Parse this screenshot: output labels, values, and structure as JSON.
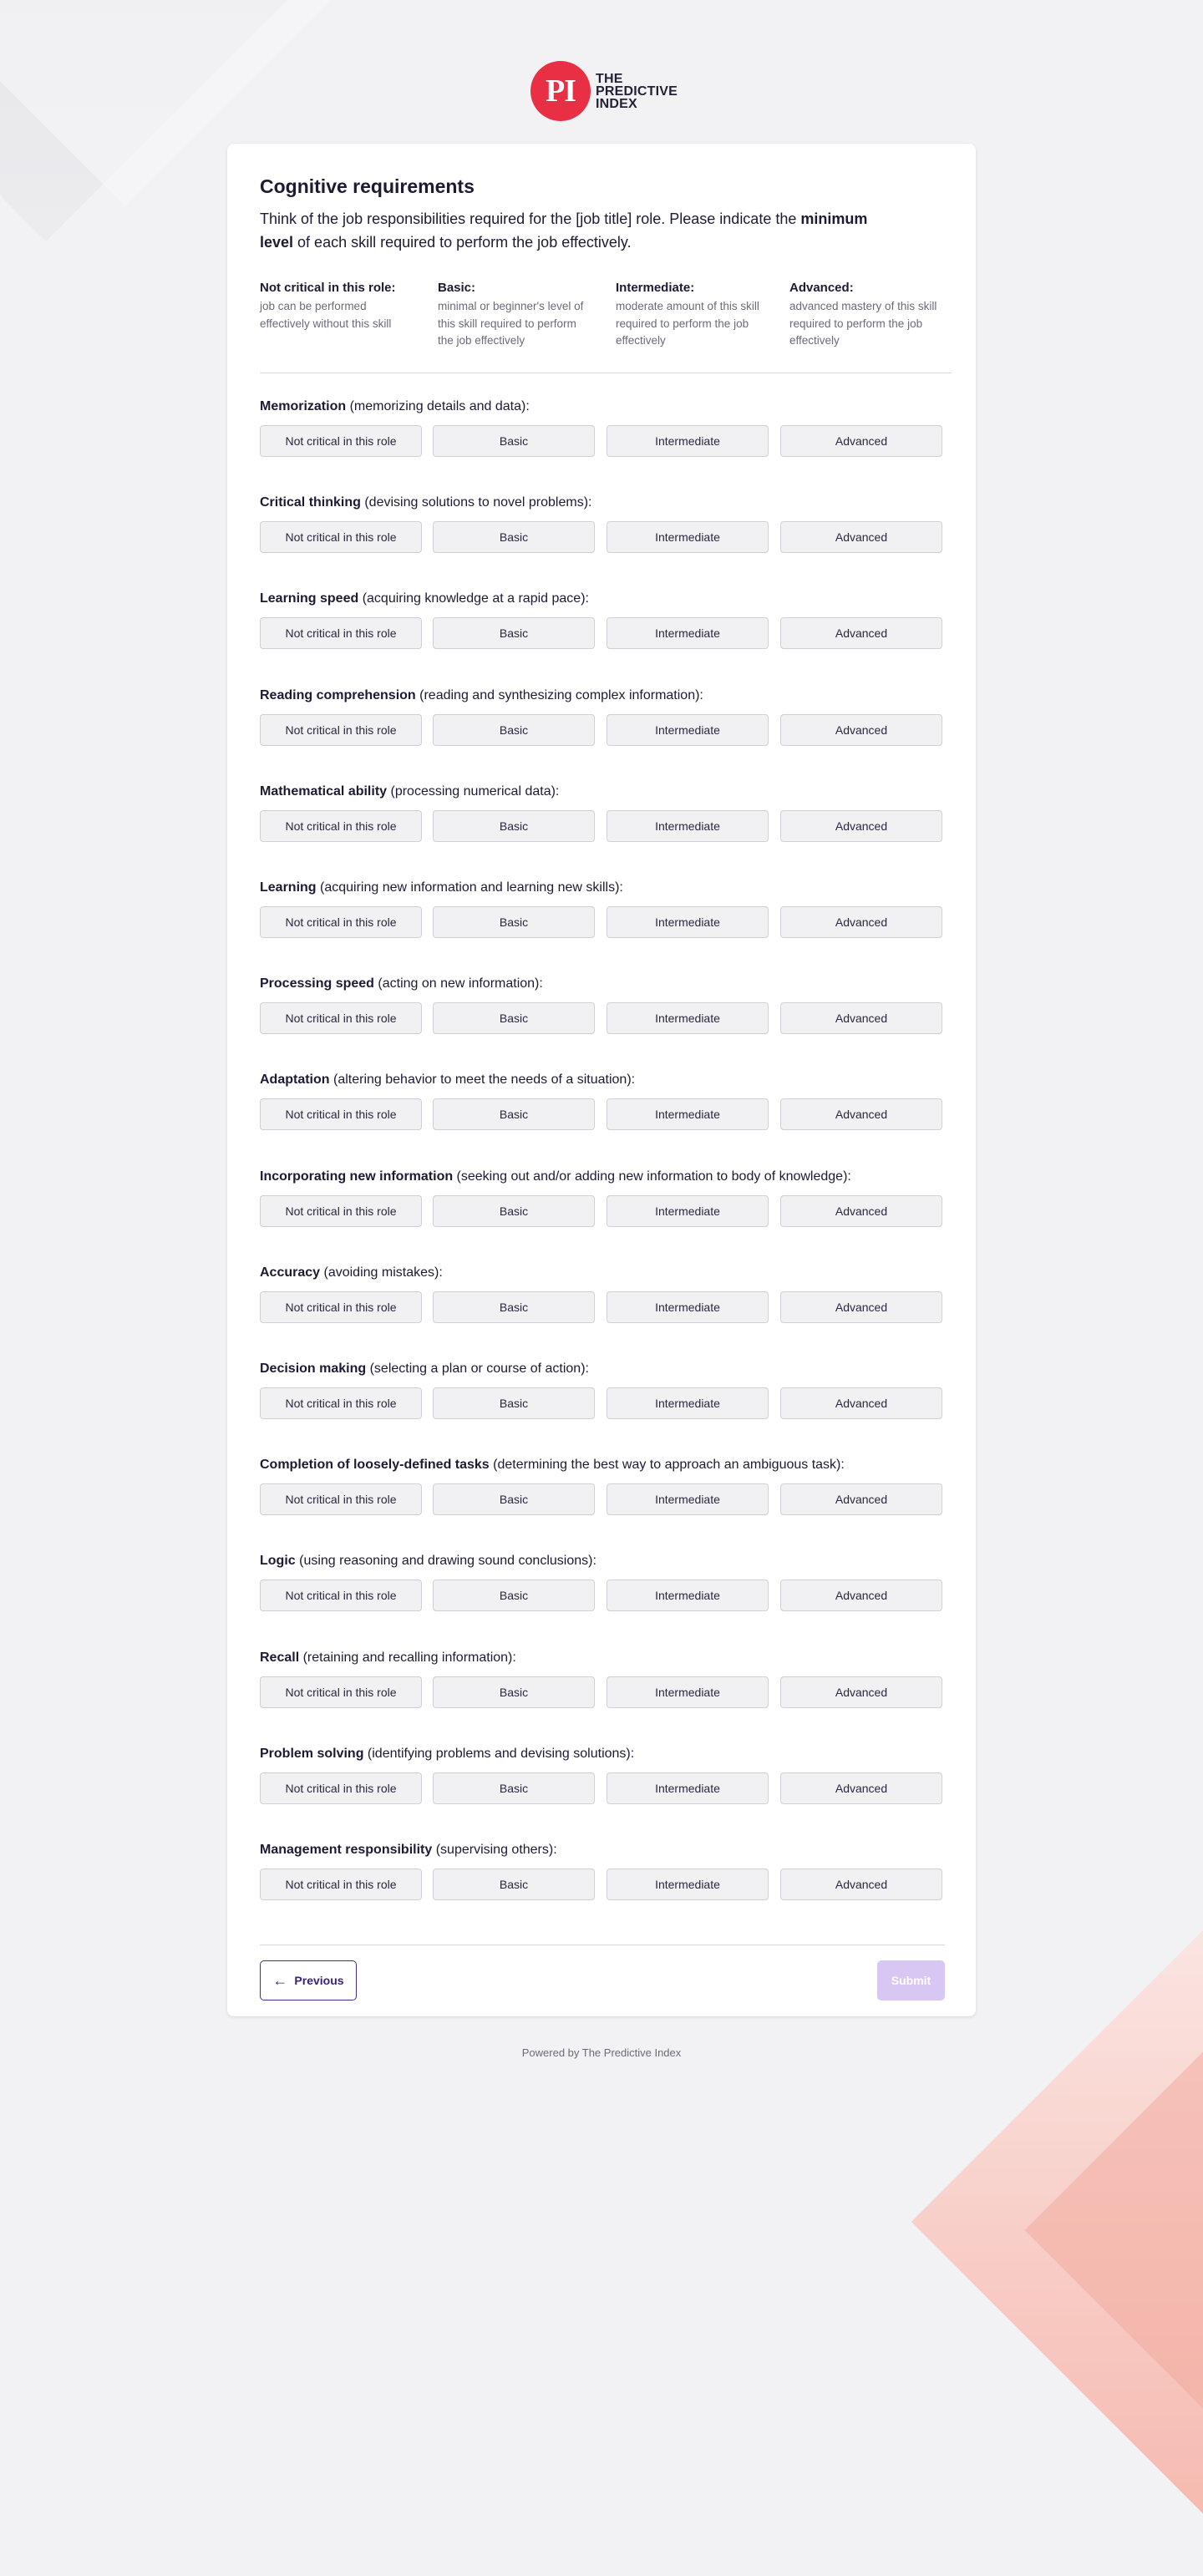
{
  "brand": {
    "logo_mark": "PI",
    "logo_line1": "THE",
    "logo_line2": "PREDICTIVE",
    "logo_line3": "INDEX",
    "accent": "#e82f44"
  },
  "form": {
    "title": "Cognitive requirements",
    "intro_pre": "Think of the job responsibilities required for the [job title] role. Please indicate the ",
    "intro_bold": "minimum level",
    "intro_post": " of each skill required to perform the job effectively.",
    "legend": [
      {
        "title": "Not critical in this role:",
        "desc": "job can be performed effectively without this skill"
      },
      {
        "title": "Basic:",
        "desc": "minimal or beginner's level of this skill required to perform the job effectively"
      },
      {
        "title": "Intermediate:",
        "desc": "moderate amount of this skill required to perform the job effectively"
      },
      {
        "title": "Advanced:",
        "desc": "advanced mastery of this skill required to perform the job effectively"
      }
    ],
    "options": [
      "Not critical in this role",
      "Basic",
      "Intermediate",
      "Advanced"
    ],
    "questions": [
      {
        "name": "Memorization",
        "desc": " (memorizing details and data):"
      },
      {
        "name": "Critical thinking",
        "desc": " (devising solutions to novel problems):"
      },
      {
        "name": "Learning speed",
        "desc": " (acquiring knowledge at a rapid pace):"
      },
      {
        "name": "Reading comprehension",
        "desc": " (reading and synthesizing complex information):"
      },
      {
        "name": "Mathematical ability",
        "desc": " (processing numerical data):"
      },
      {
        "name": "Learning",
        "desc": " (acquiring new information and learning new skills):"
      },
      {
        "name": "Processing speed",
        "desc": " (acting on new information):"
      },
      {
        "name": "Adaptation",
        "desc": " (altering behavior to meet the needs of a situation):"
      },
      {
        "name": "Incorporating new information",
        "desc": " (seeking out and/or adding new information to body of knowledge):"
      },
      {
        "name": "Accuracy",
        "desc": " (avoiding mistakes):"
      },
      {
        "name": "Decision making",
        "desc": " (selecting a plan or course of action):"
      },
      {
        "name": "Completion of loosely-defined tasks",
        "desc": " (determining the best way to approach an ambiguous task):"
      },
      {
        "name": "Logic",
        "desc": " (using reasoning and drawing sound conclusions):"
      },
      {
        "name": "Recall",
        "desc": " (retaining and recalling information):"
      },
      {
        "name": "Problem solving",
        "desc": " (identifying problems and devising solutions):"
      },
      {
        "name": "Management responsibility",
        "desc": " (supervising others):"
      }
    ],
    "previous_label": "Previous",
    "submit_label": "Submit"
  },
  "footer": {
    "text": "Powered by The Predictive Index"
  }
}
